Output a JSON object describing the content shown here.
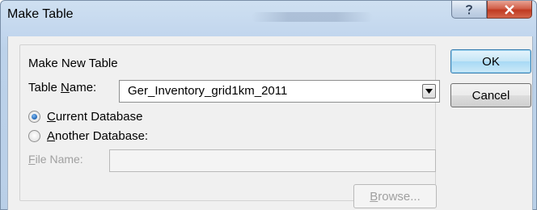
{
  "window": {
    "title": "Make Table"
  },
  "group": {
    "legend": "Make New Table"
  },
  "table_name": {
    "label_prefix": "Table ",
    "label_mnemonic": "N",
    "label_rest": "ame:",
    "value": "Ger_Inventory_grid1km_2011"
  },
  "destination": {
    "current": {
      "mnemonic": "C",
      "rest": "urrent Database",
      "selected": true
    },
    "another": {
      "mnemonic": "A",
      "rest": "nother Database:",
      "selected": false
    }
  },
  "file_name": {
    "label_mnemonic": "F",
    "label_rest": "ile Name:",
    "value": ""
  },
  "buttons": {
    "ok": "OK",
    "cancel": "Cancel",
    "browse_mnemonic": "B",
    "browse_rest": "rowse..."
  },
  "icons": {
    "help": "help-icon",
    "close": "close-icon",
    "dropdown": "chevron-down-icon"
  },
  "colors": {
    "ok_border": "#3c7fb1",
    "close_red": "#c03a22",
    "radio_dot": "#2a6fbd"
  }
}
